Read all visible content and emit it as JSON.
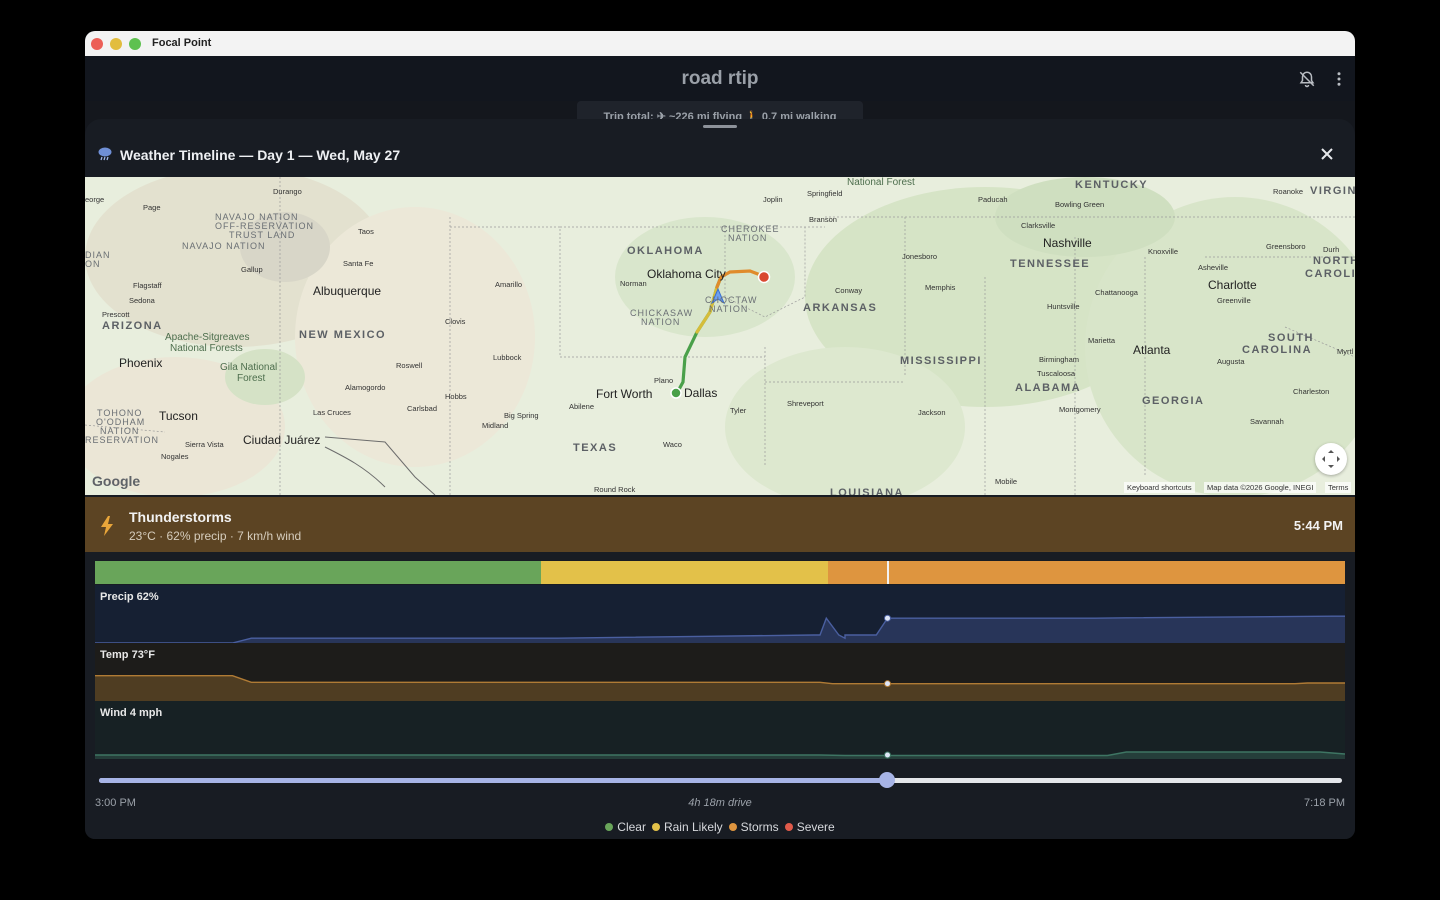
{
  "window": {
    "app_title": "Focal Point"
  },
  "appbar": {
    "trip_name": "road rtip"
  },
  "trip_summary": {
    "text": "Trip total:  ✈ ~226 mi flying  🚶 0.7 mi walking"
  },
  "sheet": {
    "title": "Weather Timeline — Day 1 — Wed, May 27"
  },
  "map": {
    "attribution_logo": "Google",
    "footer": {
      "shortcuts": "Keyboard shortcuts",
      "data": "Map data ©2026 Google, INEGI",
      "terms": "Terms"
    },
    "labels": {
      "kentucky": "KENTUCKY",
      "virginia": "VIRGINI",
      "oklahoma": "OKLAHOMA",
      "tennessee": "TENNESSEE",
      "north_carolina_1": "NORTH",
      "north_carolina_2": "CAROLIN",
      "arkansas": "ARKANSAS",
      "arizona": "ARIZONA",
      "new_mexico": "NEW MEXICO",
      "south_carolina_1": "SOUTH",
      "south_carolina_2": "CAROLINA",
      "mississippi": "MISSISSIPPI",
      "alabama": "ALABAMA",
      "georgia": "GEORGIA",
      "texas": "TEXAS",
      "louisiana": "LOUISIANA",
      "navajo_nation_otl_1": "NAVAJO NATION",
      "navajo_nation_otl_2": "OFF-RESERVATION",
      "navajo_nation_otl_3": "TRUST LAND",
      "navajo_nation": "NAVAJO NATION",
      "cherokee_1": "CHEROKEE",
      "cherokee_2": "NATION",
      "chickasaw_1": "CHICKASAW",
      "chickasaw_2": "NATION",
      "choctaw_1": "CHOCTAW",
      "choctaw_2": "NATION",
      "tohono_1": "TOHONO",
      "tohono_2": "O'ODHAM",
      "tohono_3": "NATION",
      "tohono_4": "RESERVATION",
      "apache_1": "Apache-Sitgreaves",
      "apache_2": "National Forests",
      "gila_1": "Gila National",
      "gila_2": "Forest",
      "national_forest": "National Forest",
      "dian": "DIAN",
      "on": "ON",
      "albuquerque": "Albuquerque",
      "oklahoma_city": "Oklahoma City",
      "nashville": "Nashville",
      "charlotte": "Charlotte",
      "atlanta": "Atlanta",
      "phoenix": "Phoenix",
      "tucson": "Tucson",
      "ciudad_juarez": "Ciudad Juárez",
      "fort_worth": "Fort Worth",
      "dallas": "Dallas",
      "durango": "Durango",
      "page": "Page",
      "taos": "Taos",
      "santa_fe": "Santa Fe",
      "gallup": "Gallup",
      "flagstaff": "Flagstaff",
      "sedona": "Sedona",
      "prescott": "Prescott",
      "amarillo": "Amarillo",
      "clovis": "Clovis",
      "lubbock": "Lubbock",
      "roswell": "Roswell",
      "alamogordo": "Alamogordo",
      "hobbs": "Hobbs",
      "carlsbad": "Carlsbad",
      "las_cruces": "Las Cruces",
      "sierra_vista": "Sierra Vista",
      "nogales": "Nogales",
      "springfield": "Springfield",
      "joplin": "Joplin",
      "branson": "Branson",
      "norman": "Norman",
      "conway": "Conway",
      "memphis": "Memphis",
      "jonesboro": "Jonesboro",
      "paducah": "Paducah",
      "bowling_green": "Bowling Green",
      "clarksville": "Clarksville",
      "knoxville": "Knoxville",
      "asheville": "Asheville",
      "greensboro": "Greensboro",
      "durham": "Durh",
      "roanoke": "Roanoke",
      "chattanooga": "Chattanooga",
      "huntsville": "Huntsville",
      "greenville": "Greenville",
      "marietta": "Marietta",
      "birmingham": "Birmingham",
      "tuscaloosa": "Tuscaloosa",
      "augusta": "Augusta",
      "montgomery": "Montgomery",
      "charleston": "Charleston",
      "savannah": "Savannah",
      "jackson": "Jackson",
      "shreveport": "Shreveport",
      "tyler": "Tyler",
      "waco": "Waco",
      "abilene": "Abilene",
      "big_spring": "Big Spring",
      "midland": "Midland",
      "plano": "Plano",
      "round_rock": "Round Rock",
      "mobile": "Mobile",
      "myrtle": "Myrtl",
      "eorge": "eorge"
    }
  },
  "condition": {
    "title": "Thunderstorms",
    "details": "23°C · 62% precip · 7 km/h wind",
    "time": "5:44 PM"
  },
  "timeline": {
    "start_label": "3:00 PM",
    "mid_label": "4h 18m drive",
    "end_label": "7:18 PM",
    "position_fraction": 0.634,
    "colors": {
      "clear": "#69a55a",
      "rain": "#e3c149",
      "storms": "#de953f",
      "severe": "#df5a4a"
    },
    "bands": [
      {
        "condition": "clear",
        "start": 0.0,
        "end": 0.357
      },
      {
        "condition": "rain",
        "start": 0.357,
        "end": 0.586
      },
      {
        "condition": "storms",
        "start": 0.586,
        "end": 1.0
      }
    ]
  },
  "charts": {
    "precip": {
      "label": "Precip  62%",
      "color": "#4a5fa0",
      "y_range": [
        0,
        100
      ],
      "points": [
        [
          0,
          0
        ],
        [
          0.11,
          0
        ],
        [
          0.125,
          12
        ],
        [
          0.35,
          12
        ],
        [
          0.36,
          12
        ],
        [
          0.37,
          12
        ],
        [
          0.355,
          12
        ],
        [
          0.6,
          12
        ],
        [
          0.575,
          20
        ],
        [
          0.595,
          20
        ],
        [
          0.61,
          20
        ],
        [
          0.625,
          20
        ],
        [
          0.6,
          20
        ],
        [
          0.58,
          20
        ],
        [
          0.585,
          62
        ],
        [
          0.634,
          62
        ],
        [
          0.8,
          62
        ],
        [
          0.825,
          63
        ],
        [
          0.99,
          67
        ],
        [
          1.0,
          67
        ]
      ],
      "marker": [
        0.634,
        62
      ]
    },
    "temp": {
      "label": "Temp  73°F",
      "color": "#b07b35",
      "y_range": [
        60,
        90
      ],
      "points": [
        [
          0,
          79
        ],
        [
          0.11,
          79
        ],
        [
          0.125,
          74
        ],
        [
          0.58,
          74
        ],
        [
          0.59,
          73
        ],
        [
          0.634,
          73
        ],
        [
          0.96,
          73
        ],
        [
          0.97,
          73.5
        ],
        [
          1.0,
          73.5
        ]
      ],
      "marker": [
        0.634,
        73
      ]
    },
    "wind": {
      "label": "Wind  4 mph",
      "color": "#3e7563",
      "y_range": [
        0,
        40
      ],
      "points": [
        [
          0,
          4
        ],
        [
          0.58,
          4
        ],
        [
          0.6,
          3.5
        ],
        [
          0.634,
          3.5
        ],
        [
          0.81,
          3.5
        ],
        [
          0.825,
          7
        ],
        [
          0.98,
          7
        ],
        [
          1.0,
          5
        ]
      ],
      "marker": [
        0.634,
        4
      ]
    }
  },
  "legend": [
    {
      "label": "Clear",
      "color": "#69a55a"
    },
    {
      "label": "Rain Likely",
      "color": "#e3c149"
    },
    {
      "label": "Storms",
      "color": "#de953f"
    },
    {
      "label": "Severe",
      "color": "#df5a4a"
    }
  ]
}
